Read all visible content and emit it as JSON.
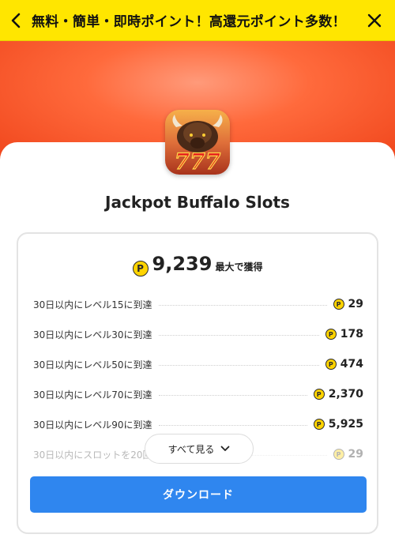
{
  "topbar": {
    "title": "無料・簡単・即時ポイント！高還元ポイント多数！"
  },
  "app": {
    "name": "Jackpot Buffalo Slots",
    "icon_text": "777"
  },
  "points": {
    "coin_symbol": "P",
    "total": "9,239",
    "total_suffix": "最大で獲得"
  },
  "tasks": [
    {
      "label": "30日以内にレベル15に到達",
      "reward": "29"
    },
    {
      "label": "30日以内にレベル30に到達",
      "reward": "178"
    },
    {
      "label": "30日以内にレベル50に到達",
      "reward": "474"
    },
    {
      "label": "30日以内にレベル70に到達",
      "reward": "2,370"
    },
    {
      "label": "30日以内にレベル90に到達",
      "reward": "5,925"
    },
    {
      "label": "30日以内にスロットを20回",
      "reward": "29"
    }
  ],
  "buttons": {
    "see_all": "すべて見る",
    "download": "ダウンロード"
  },
  "colors": {
    "topbar": "#ffe600",
    "hero": "#f0461c",
    "coin": "#ffd400",
    "download": "#2f86ef"
  }
}
